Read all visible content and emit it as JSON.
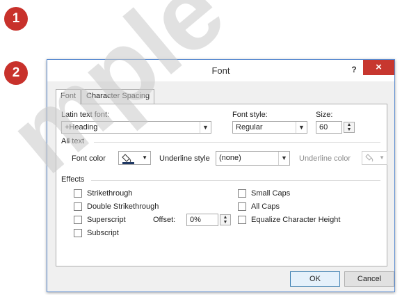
{
  "callouts": [
    "1",
    "2"
  ],
  "watermark": "mple",
  "dialog": {
    "title": "Font",
    "help": "?",
    "close": "×",
    "tabs": [
      {
        "label": "Font",
        "active": true
      },
      {
        "label": "Character Spacing",
        "active": false
      }
    ],
    "font": {
      "latin_label": "Latin text font:",
      "latin_value": "+Heading",
      "style_label": "Font style:",
      "style_value": "Regular",
      "size_label": "Size:",
      "size_value": "60"
    },
    "all_text": {
      "group_label": "All text",
      "font_color_label": "Font color",
      "underline_style_label": "Underline style",
      "underline_style_value": "(none)",
      "underline_color_label": "Underline color"
    },
    "effects": {
      "group_label": "Effects",
      "left": [
        {
          "label": "Strikethrough",
          "checked": false
        },
        {
          "label": "Double Strikethrough",
          "checked": false
        },
        {
          "label": "Superscript",
          "checked": false
        },
        {
          "label": "Subscript",
          "checked": false
        }
      ],
      "right": [
        {
          "label": "Small Caps",
          "checked": false
        },
        {
          "label": "All Caps",
          "checked": false
        },
        {
          "label": "Equalize Character Height",
          "checked": false
        }
      ],
      "offset_label": "Offset:",
      "offset_value": "0%"
    },
    "buttons": {
      "ok": "OK",
      "cancel": "Cancel"
    }
  },
  "colors": {
    "callout": "#c8312b",
    "close": "#c7372f",
    "dialog_border": "#5a8bd0",
    "font_color_swatch": "#1f3864"
  }
}
